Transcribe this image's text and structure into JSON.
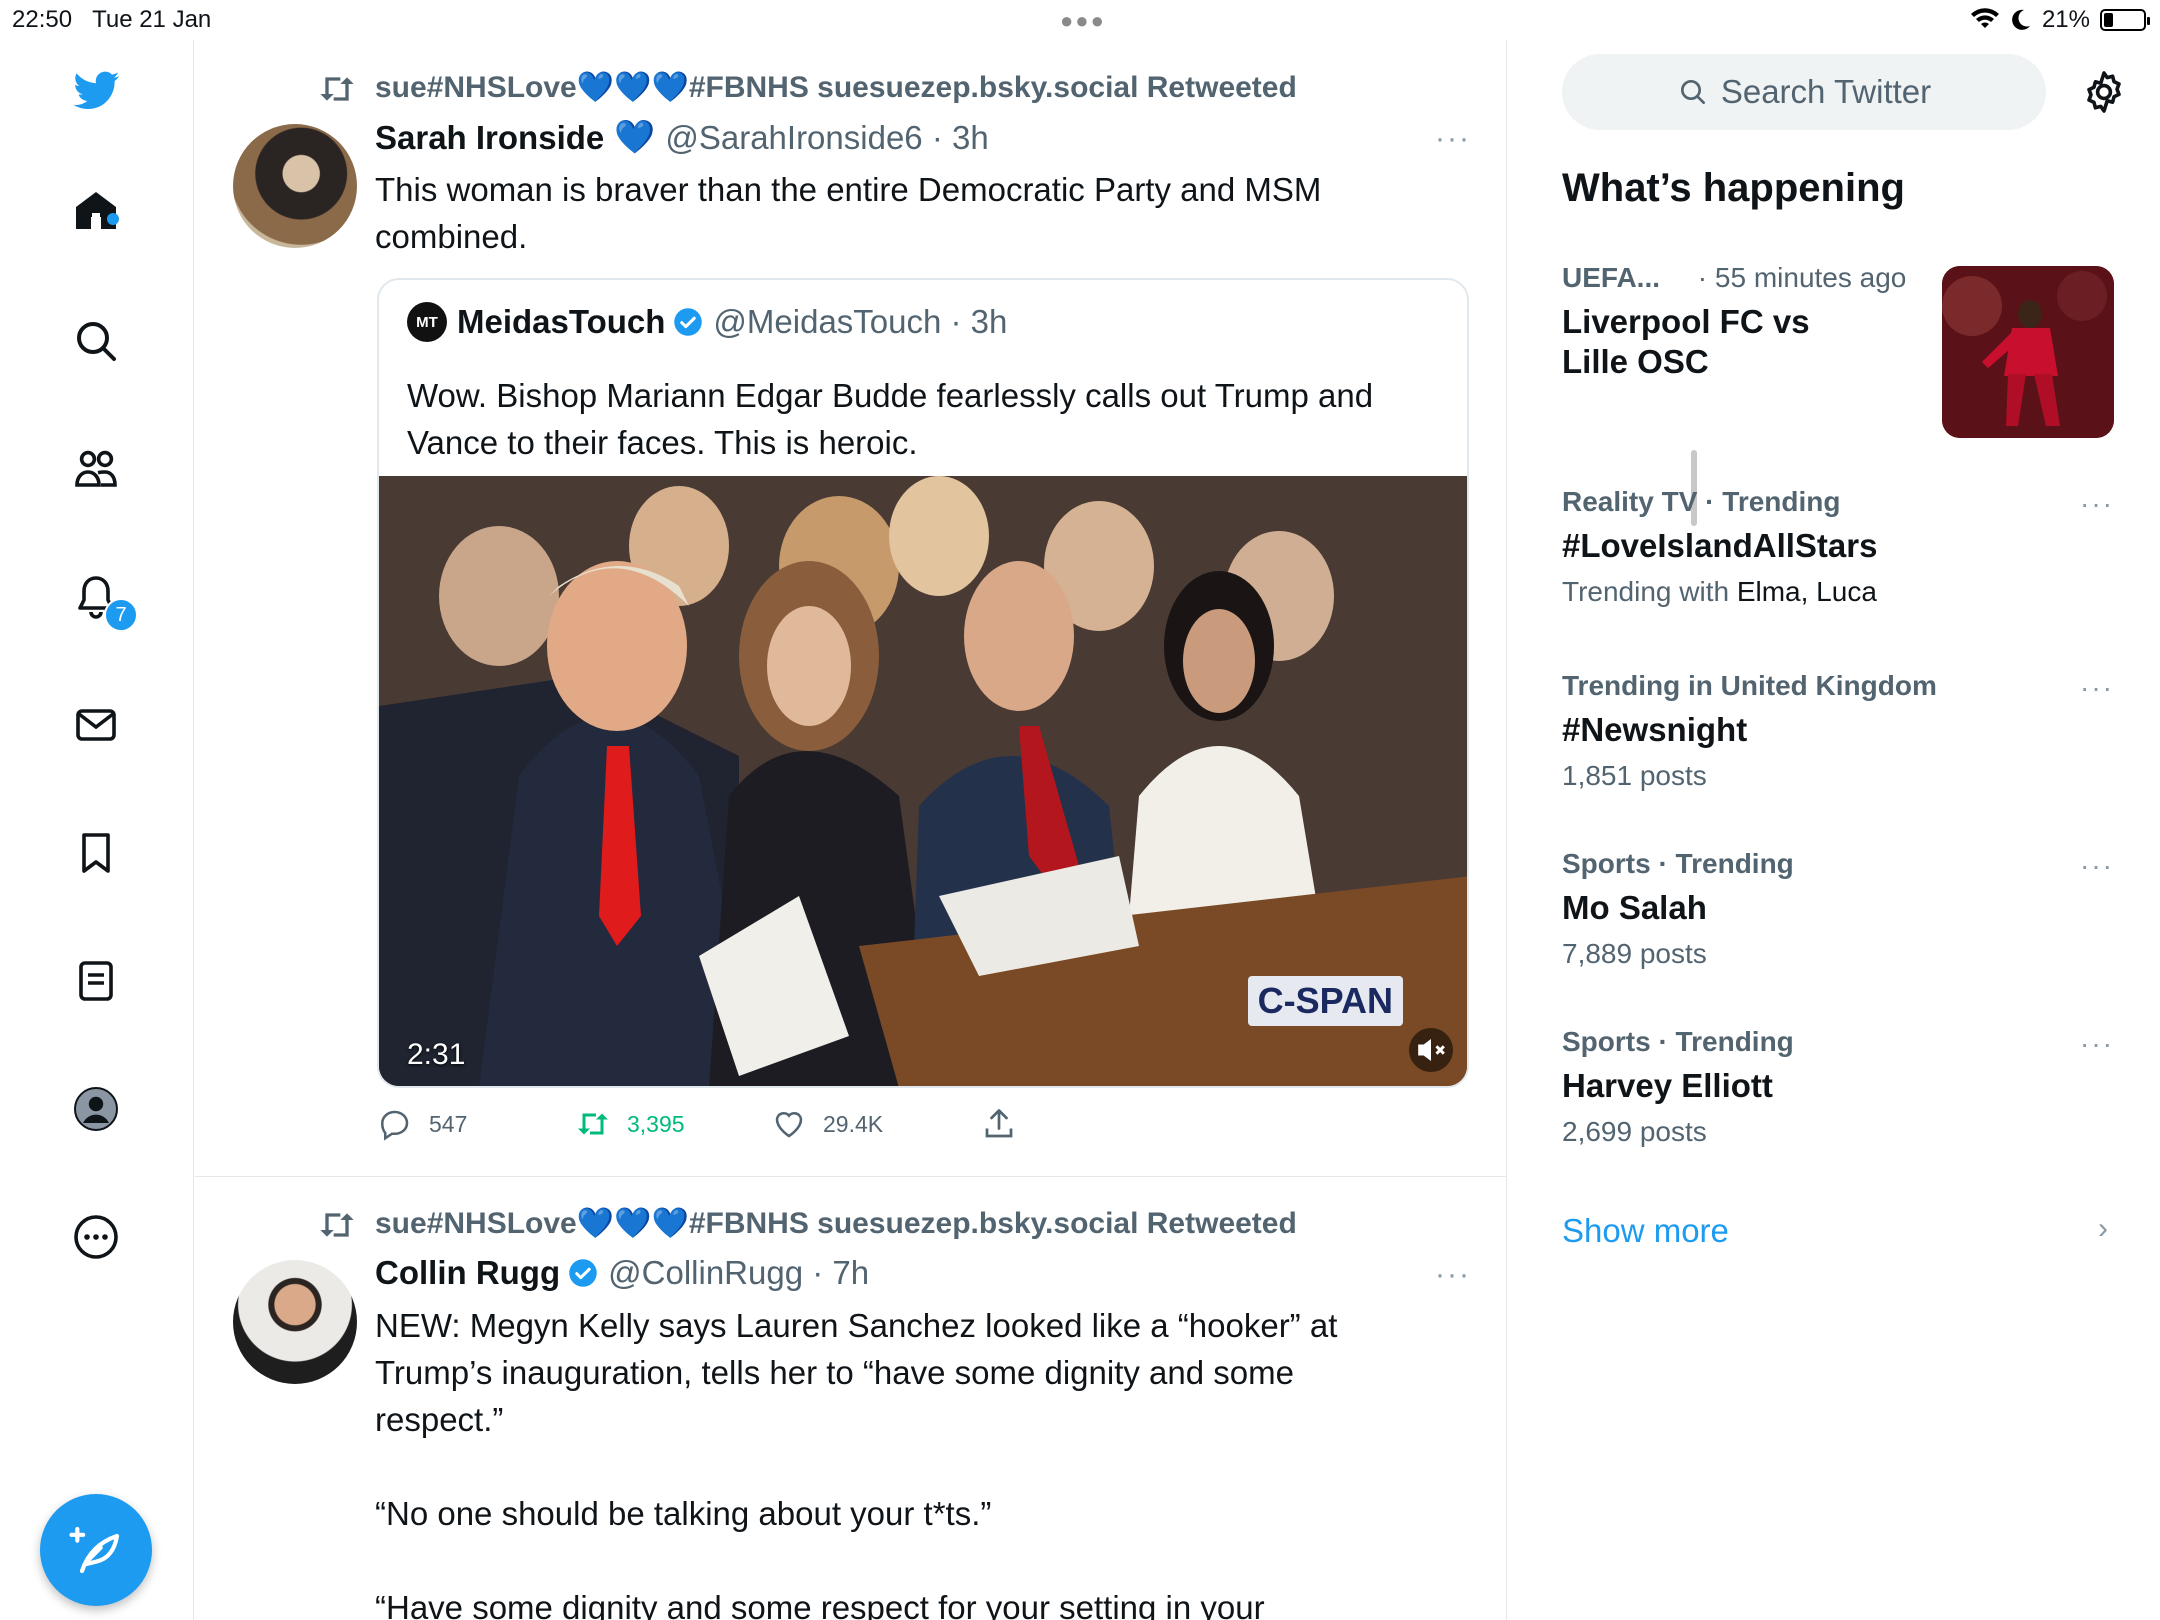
{
  "status_bar": {
    "time": "22:50",
    "date": "Tue 21 Jan",
    "battery": "21%",
    "wifi_icon": "wifi-icon",
    "moon_icon": "moon-icon"
  },
  "nav": {
    "logo": "twitter-bird-icon",
    "items": [
      {
        "name": "home",
        "icon": "home-icon"
      },
      {
        "name": "explore",
        "icon": "search-icon"
      },
      {
        "name": "communities",
        "icon": "communities-icon"
      },
      {
        "name": "notifications",
        "icon": "bell-icon"
      },
      {
        "name": "messages",
        "icon": "envelope-icon"
      },
      {
        "name": "bookmarks",
        "icon": "bookmark-icon"
      },
      {
        "name": "lists",
        "icon": "list-icon"
      },
      {
        "name": "profile",
        "icon": "profile-icon"
      },
      {
        "name": "more",
        "icon": "more-circle-icon"
      }
    ],
    "notifications_badge": "7",
    "compose_icon": "compose-feather-icon"
  },
  "timeline": {
    "tweets": [
      {
        "retweeted_by_prefix": "sue#NHSLove",
        "retweeted_by_suffix": "#FBNHS suesuezep.bsky.social Retweeted",
        "hearts": "💙💙💙",
        "name": "Sarah Ironside",
        "name_heart": "💙",
        "handle_time": "@SarahIronside6 · 3h",
        "more": "···",
        "text": "This woman is braver than the entire Democratic Party and MSM\ncombined.",
        "quote": {
          "logo": "MT",
          "name": "MeidasTouch",
          "handle_time": "@MeidasTouch · 3h",
          "text": "Wow. Bishop Mariann Edgar Budde fearlessly calls out Trump and\nVance to their faces. This is heroic.",
          "video_duration": "2:31",
          "watermark": "C-SPAN"
        },
        "actions": {
          "replies": "547",
          "retweets": "3,395",
          "likes": "29.4K"
        }
      },
      {
        "retweeted_by_prefix": "sue#NHSLove",
        "retweeted_by_suffix": "#FBNHS suesuezep.bsky.social Retweeted",
        "hearts": "💙💙💙",
        "name": "Collin Rugg",
        "handle_time": "@CollinRugg · 7h",
        "more": "···",
        "text": "NEW: Megyn Kelly says Lauren Sanchez looked like a “hooker” at\nTrump’s inauguration, tells her to “have some dignity and some\nrespect.”\n\n“No one should be talking about your t*ts.”\n\n“Have some dignity and some respect for your setting in your"
      }
    ]
  },
  "sidebar": {
    "search_placeholder": "Search Twitter",
    "whats_happening": "What’s happening",
    "trends": [
      {
        "meta": "UEFA...",
        "meta_extra": " · 55 minutes ago",
        "title": "Liverpool FC vs\nLille OSC",
        "sub": ""
      },
      {
        "meta": "Reality TV · Trending",
        "title": "#LoveIslandAllStars",
        "sub_prefix": "Trending with ",
        "sub": "Elma, Luca"
      },
      {
        "meta": "Trending in United Kingdom",
        "title": "#Newsnight",
        "sub": "1,851 posts"
      },
      {
        "meta": "Sports · Trending",
        "title": "Mo Salah",
        "sub": "7,889 posts"
      },
      {
        "meta": "Sports · Trending",
        "title": "Harvey Elliott",
        "sub": "2,699 posts"
      }
    ],
    "show_more": "Show more"
  },
  "colors": {
    "accent": "#1d9bf0",
    "retweet_green": "#00ba7c",
    "text": "#0f1419",
    "muted": "#536471"
  }
}
